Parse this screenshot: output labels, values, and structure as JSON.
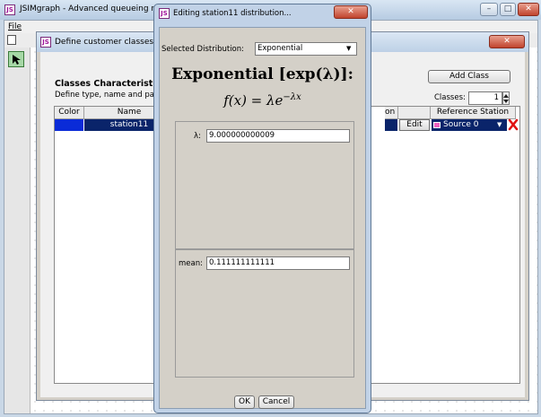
{
  "main_window": {
    "title": "JSIMgraph - Advanced queueing n",
    "menu_first": "File"
  },
  "classes_dialog": {
    "title": "Define customer classes",
    "heading": "Classes Characteristics",
    "description": "Define type, name and para",
    "add_class_label": "Add Class",
    "classes_count_label": "Classes:",
    "classes_count_value": "1",
    "columns": {
      "color": "Color",
      "name": "Name",
      "population_partial": "on",
      "reference_station": "Reference Station"
    },
    "rows": [
      {
        "color": "#0a2bd8",
        "name": "station11",
        "edit_label": "Edit",
        "reference_station": "Source 0"
      }
    ]
  },
  "distribution_dialog": {
    "title": "Editing station11 distribution...",
    "selected_label": "Selected Distribution:",
    "selected_value": "Exponential",
    "heading": "Exponential [exp(λ)]:",
    "formula": "f(x) = λe",
    "formula_exponent": "−λx",
    "lambda_label": "λ:",
    "lambda_value": "9.000000000009",
    "mean_label": "mean:",
    "mean_value": "0.111111111111",
    "ok_label": "OK",
    "cancel_label": "Cancel"
  },
  "colors": {
    "selection_blue": "#0a246a",
    "class_color": "#0a2bd8",
    "remove_red": "#e01010"
  }
}
